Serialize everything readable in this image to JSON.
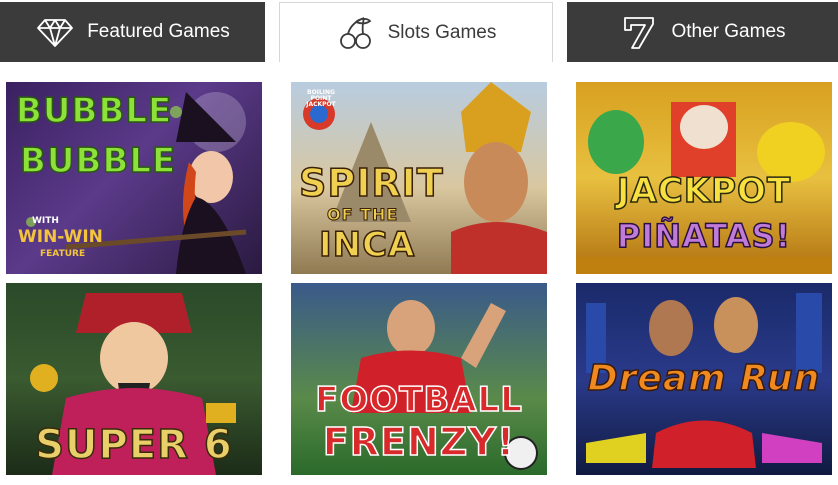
{
  "tabs": [
    {
      "label": "Featured Games",
      "icon": "diamond-icon"
    },
    {
      "label": "Slots Games",
      "icon": "cherries-icon",
      "active": true
    },
    {
      "label": "Other Games",
      "icon": "seven-icon"
    }
  ],
  "games": [
    {
      "line1": "BUBBLE",
      "line2": "BUBBLE",
      "badge_with": "WITH",
      "badge_main": "WIN-WIN",
      "badge_sub": "FEATURE"
    },
    {
      "line1": "SPIRIT",
      "line2": "OF THE",
      "line3": "INCA",
      "badge": "BOILING POINT JACKPOT"
    },
    {
      "line1": "JACKPOT",
      "line2": "PIÑATAS!"
    },
    {
      "line1": "SUPER 6"
    },
    {
      "line1": "FOOTBALL",
      "line2": "FRENZY!"
    },
    {
      "line1": "Dream Run"
    }
  ],
  "colors": {
    "tab_dark": "#3b3b3b",
    "tab_text_light": "#ffffff",
    "tab_text_dark": "#3b3b3b"
  }
}
